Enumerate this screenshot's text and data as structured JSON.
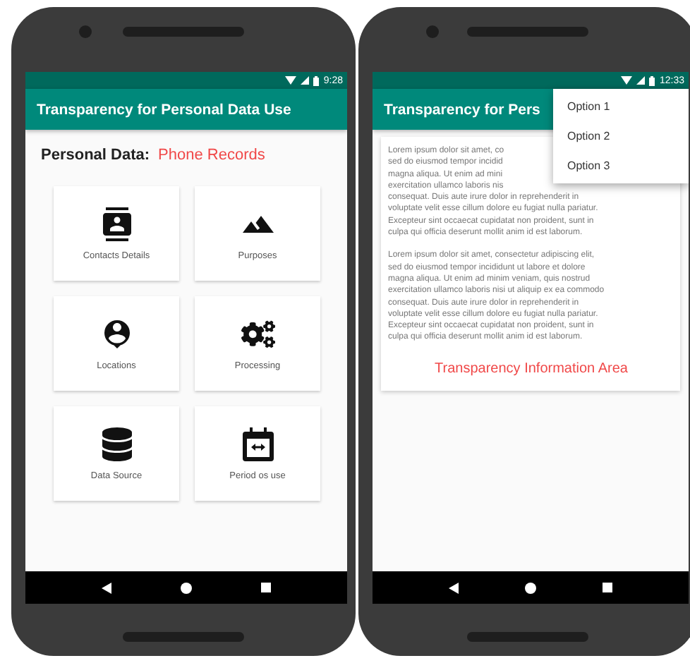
{
  "phones": [
    {
      "kind": "grid",
      "status_time": "9:28",
      "app_title": "Transparency for Personal Data Use",
      "personal_data_label": "Personal Data:",
      "personal_data_value": "Phone Records",
      "tiles": [
        {
          "kind": "contacts",
          "label": "Contacts Details"
        },
        {
          "kind": "purposes",
          "label": "Purposes"
        },
        {
          "kind": "locations",
          "label": "Locations"
        },
        {
          "kind": "processing",
          "label": "Processing"
        },
        {
          "kind": "database",
          "label": "Data Source"
        },
        {
          "kind": "period",
          "label": "Period os use"
        }
      ]
    },
    {
      "kind": "info",
      "status_time": "12:33",
      "app_title": "Transparency for Pers",
      "paragraphs": [
        [
          "Lorem ipsum dolor sit amet, co",
          "sed do eiusmod tempor incidid",
          "magna aliqua. Ut enim ad mini",
          "exercitation ullamco laboris nis",
          "consequat. Duis aute irure dolor in reprehenderit in",
          "voluptate velit esse cillum dolore eu fugiat nulla pariatur.",
          "Excepteur sint occaecat cupidatat non proident, sunt in",
          "culpa qui officia deserunt mollit anim id est laborum."
        ],
        [
          "Lorem ipsum dolor sit amet, consectetur adipiscing elit,",
          "sed do eiusmod tempor incididunt ut labore et dolore",
          "magna aliqua. Ut enim ad minim veniam, quis nostrud",
          "exercitation ullamco laboris nisi ut aliquip ex ea commodo",
          "consequat. Duis aute irure dolor in reprehenderit in",
          "voluptate velit esse cillum dolore eu fugiat nulla pariatur.",
          "Excepteur sint occaecat cupidatat non proident, sunt in",
          "culpa qui officia deserunt mollit anim id est laborum."
        ]
      ],
      "info_title": "Transparency Information Area",
      "menu": [
        "Option 1",
        "Option 2",
        "Option 3"
      ]
    }
  ]
}
